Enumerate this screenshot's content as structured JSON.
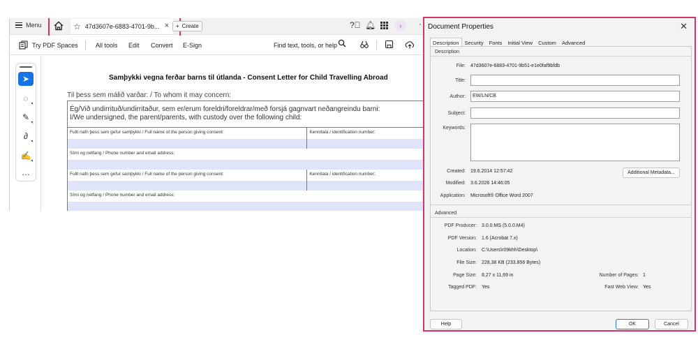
{
  "app": {
    "menu_label": "Menu",
    "tab_title": "47d3607e-6883-4701-9b...",
    "create_label": "Create",
    "avatar_initial": "♁",
    "toolbar": {
      "try_spaces": "Try PDF Spaces",
      "all_tools": "All tools",
      "edit": "Edit",
      "convert": "Convert",
      "esign": "E-Sign",
      "find_text": "Find text, tools, or help"
    }
  },
  "document": {
    "title": "Samþykki vegna ferðar barns til útlanda - Consent Letter for Child Travelling Abroad",
    "concern": "Til þess sem málið varðar: / To whom it may concern:",
    "intro_line1": "Ég/Við undirrituð/undirritaður, sem er/erum foreldri/foreldrar/með forsjá gagnvart neðangreindu barni:",
    "intro_line2": "I/We undersigned, the parent/parents, with custody over the following child:",
    "full_name_label": "Fullt nafn þess sem gefur samþykki / Full name of the person giving consent:",
    "id_label": "Kennitala / identification number:",
    "phone_label": "Sími og netfang / Phone number and email address:"
  },
  "dialog": {
    "title": "Document Properties",
    "tabs": [
      "Description",
      "Security",
      "Fonts",
      "Initial View",
      "Custom",
      "Advanced"
    ],
    "description_group": "Description",
    "file_label": "File:",
    "file_value": "47d3607e-6883-4701-9b51-e1e0faf9bfdb",
    "title_label": "Title:",
    "title_value": "",
    "author_label": "Author:",
    "author_value": "EW/LN/CB",
    "subject_label": "Subject:",
    "subject_value": "",
    "keywords_label": "Keywords:",
    "keywords_value": "",
    "created_label": "Created:",
    "created_value": "19.6.2014 12:57:42",
    "modified_label": "Modified:",
    "modified_value": "3.6.2026 14:46:05",
    "application_label": "Application:",
    "application_value": "Microsoft® Office Word 2007",
    "additional_metadata": "Additional Metadata...",
    "advanced_group": "Advanced",
    "producer_label": "PDF Producer:",
    "producer_value": "3.0.0.MS (5.0.0.M4)",
    "version_label": "PDF Version:",
    "version_value": "1.6 (Acrobat 7.x)",
    "location_label": "Location:",
    "location_value": "C:\\Users\\r09khh\\Desktop\\",
    "filesize_label": "File Size:",
    "filesize_value": "228,38 KB (233.856 Bytes)",
    "pagesize_label": "Page Size:",
    "pagesize_value": "8,27 x 11,69 in",
    "numpages_label": "Number of Pages:",
    "numpages_value": "1",
    "tagged_label": "Tagged PDF:",
    "tagged_value": "Yes",
    "fastweb_label": "Fast Web View:",
    "fastweb_value": "Yes",
    "help_label": "Help",
    "ok_label": "OK",
    "cancel_label": "Cancel"
  },
  "colors": {
    "highlight": "#d6336c",
    "active_tool": "#1473e6",
    "form_fill": "#dfe4fb"
  }
}
